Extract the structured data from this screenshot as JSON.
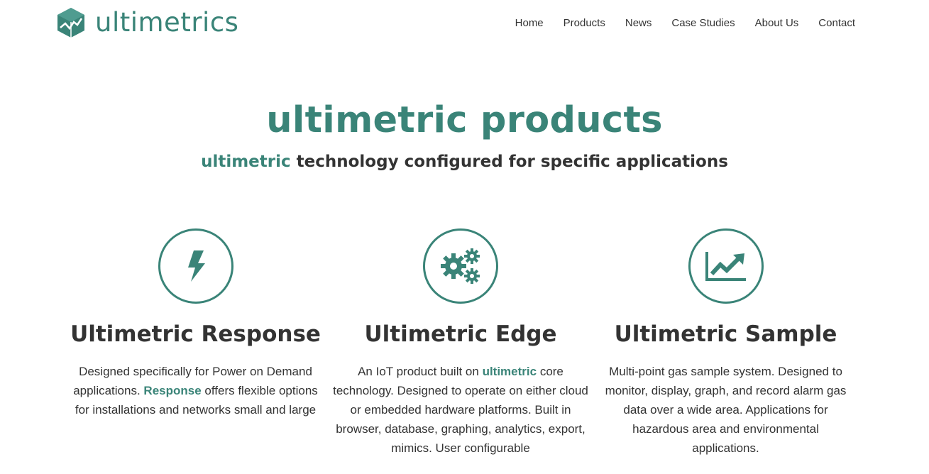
{
  "brand": {
    "name": "ultimetrics",
    "accent_color": "#3a8478",
    "logo_icon": "cube-logo-icon"
  },
  "nav": {
    "items": [
      {
        "label": "Home"
      },
      {
        "label": "Products"
      },
      {
        "label": "News"
      },
      {
        "label": "Case Studies"
      },
      {
        "label": "About Us"
      },
      {
        "label": "Contact"
      }
    ]
  },
  "hero": {
    "title": "ultimetric products",
    "subtitle_accent": "ultimetric",
    "subtitle_rest": " technology configured for specific applications"
  },
  "products": [
    {
      "icon": "lightning-bolt-icon",
      "title": "Ultimetric Response",
      "desc_before": "Designed specifically for Power on Demand applications. ",
      "desc_highlight": "Response",
      "desc_after": " offers flexible options for installations and networks small and large"
    },
    {
      "icon": "gears-icon",
      "title": "Ultimetric Edge",
      "desc_before": "An IoT product built on ",
      "desc_highlight": "ultimetric",
      "desc_after": " core technology. Designed to operate on either cloud or embedded hardware platforms. Built in browser, database, graphing, analytics, export, mimics. User configurable"
    },
    {
      "icon": "line-chart-icon",
      "title": "Ultimetric Sample",
      "desc_before": "Multi-point gas sample system. Designed to monitor, display, graph, and record alarm gas data over a wide area. Applications for hazardous area and environmental applications.",
      "desc_highlight": "",
      "desc_after": ""
    }
  ]
}
